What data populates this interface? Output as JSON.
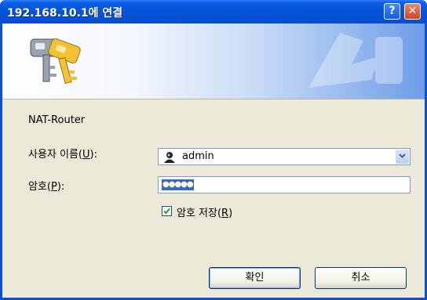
{
  "window": {
    "title": "192.168.10.1에 연결",
    "help_glyph": "?",
    "close_glyph": "✕"
  },
  "dialog": {
    "realm": "NAT-Router",
    "username_label_pre": "사용자 이름(",
    "username_label_key": "U",
    "username_label_post": "):",
    "username_value": "admin",
    "password_label_pre": "암호(",
    "password_label_key": "P",
    "password_label_post": "):",
    "password_mask": "●●●●●",
    "remember_label_pre": "암호 저장(",
    "remember_label_key": "R",
    "remember_label_post": ")",
    "remember_checked": true,
    "ok_label": "확인",
    "cancel_label": "취소"
  },
  "colors": {
    "titlebar": "#0553d8",
    "client_bg": "#ece9d8",
    "selection": "#316ac5",
    "field_border": "#7f9db9"
  },
  "icons": [
    "keys-icon",
    "user-icon",
    "chevron-down-icon",
    "help-icon",
    "close-icon",
    "check-icon"
  ]
}
